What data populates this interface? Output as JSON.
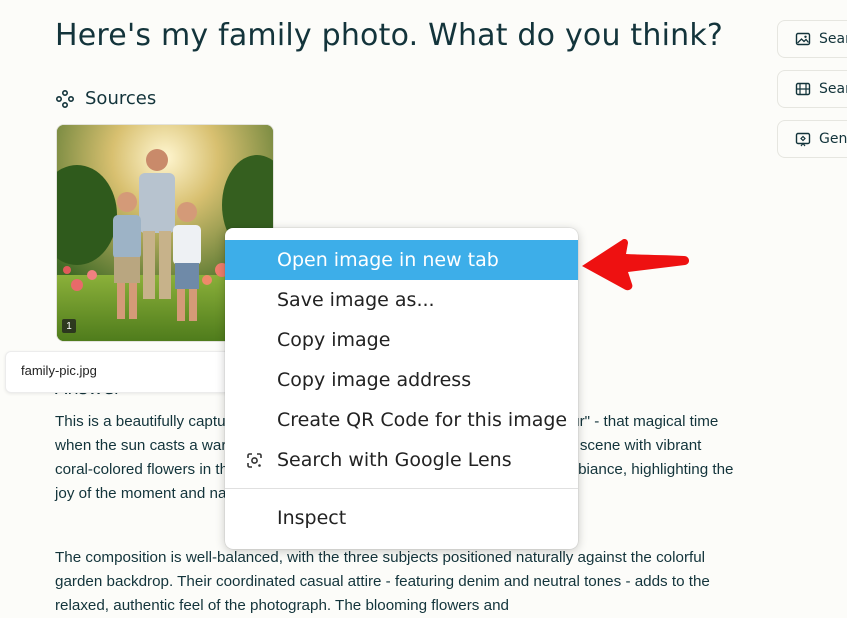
{
  "question": "Here's my family photo. What do you think?",
  "sources": {
    "heading": "Sources",
    "badge": "1",
    "tooltip": "family-pic.jpg"
  },
  "answer": {
    "heading": "Answer",
    "paragraph1": "This is a beautifully captured family portrait that appears to be the \"golden hour\" - that magical time when the sun casts a warm, golden glow. The image features a heartwarming scene with vibrant coral-colored flowers in the background. The soft lighting creates a perfect ambiance, highlighting the joy of the moment and nature.",
    "paragraph2": "The composition is well-balanced, with the three subjects positioned naturally against the colorful garden backdrop. Their coordinated casual attire - featuring denim and neutral tones - adds to the relaxed, authentic feel of the photograph. The blooming flowers and"
  },
  "side_buttons": [
    {
      "label": "Search Images",
      "icon": "image-icon"
    },
    {
      "label": "Search Videos",
      "icon": "film-icon"
    },
    {
      "label": "Generate Image",
      "icon": "generate-image-icon"
    }
  ],
  "context_menu": {
    "items": [
      {
        "label": "Open image in new tab",
        "highlighted": true
      },
      {
        "label": "Save image as..."
      },
      {
        "label": "Copy image"
      },
      {
        "label": "Copy image address"
      },
      {
        "label": "Create QR Code for this image"
      },
      {
        "label": "Search with Google Lens",
        "icon": "google-lens-icon"
      },
      {
        "label": "Inspect"
      }
    ]
  },
  "colors": {
    "highlight": "#3daee9",
    "arrow": "#ee1111",
    "text": "#13343b"
  }
}
